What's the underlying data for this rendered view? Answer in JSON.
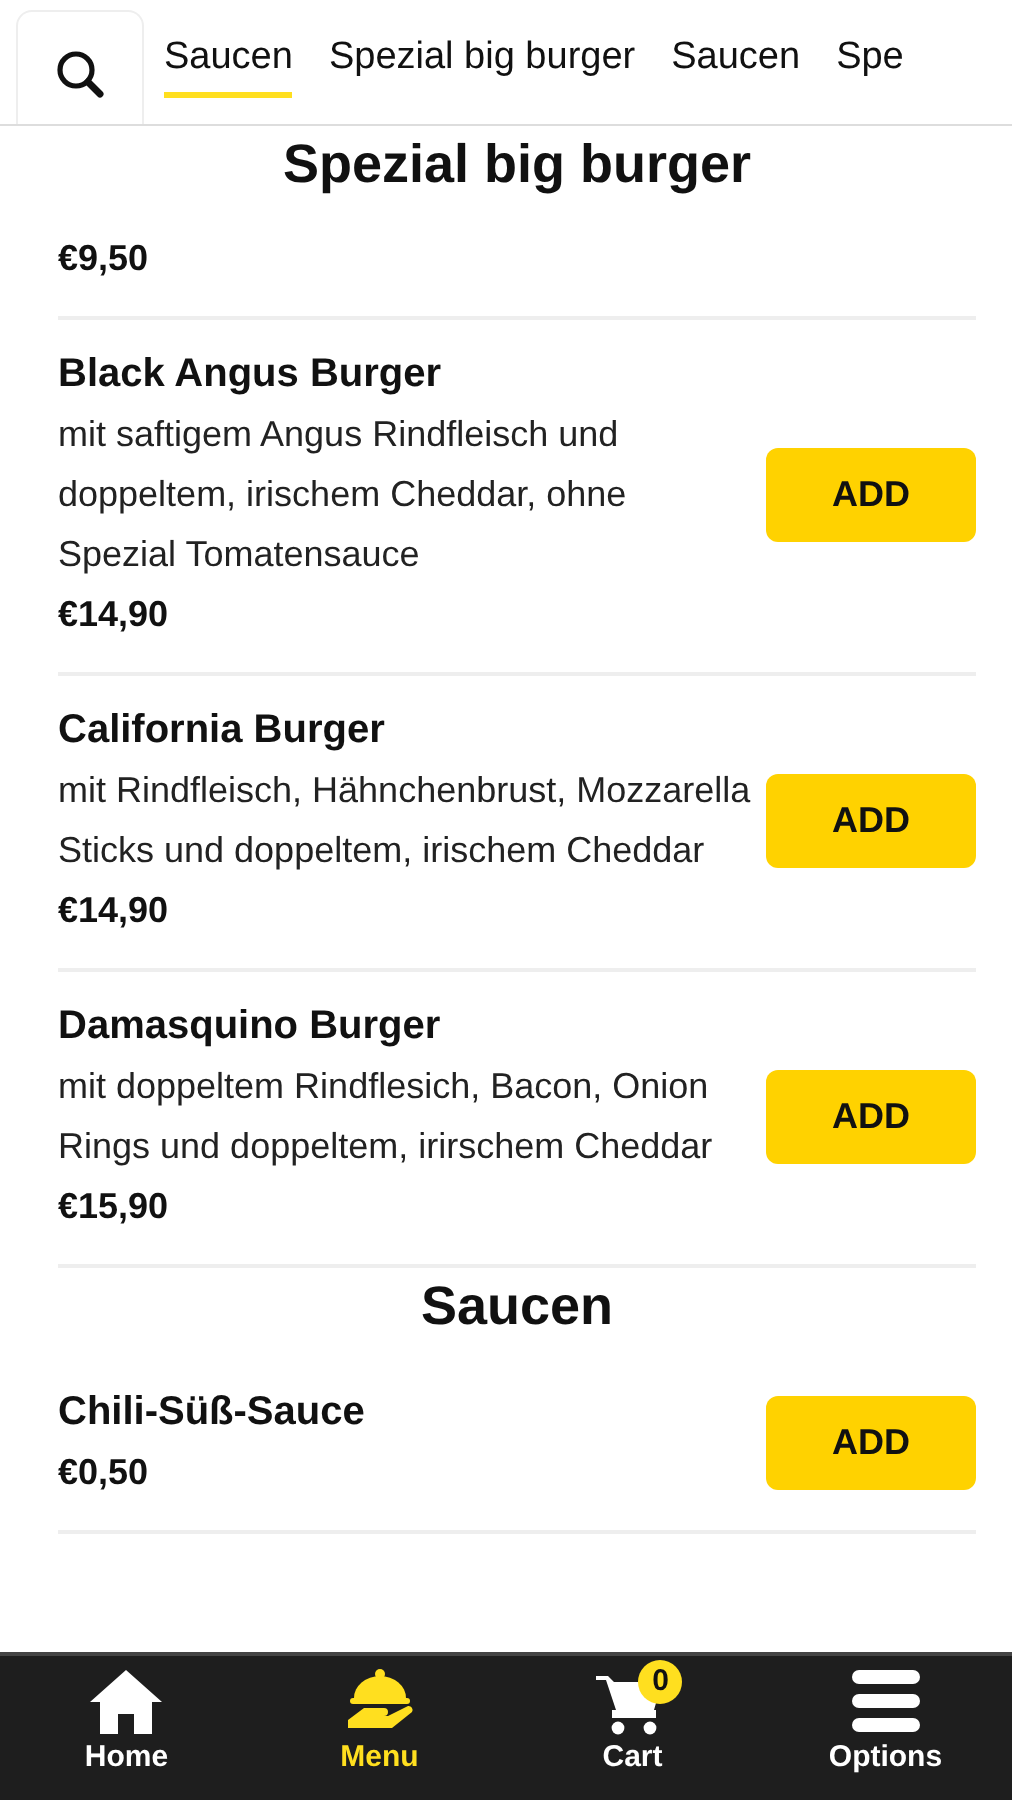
{
  "tabs": [
    {
      "label": "Saucen",
      "selected": true
    },
    {
      "label": "Spezial big burger",
      "selected": false
    },
    {
      "label": "Saucen",
      "selected": false
    },
    {
      "label": "Spe",
      "selected": false
    }
  ],
  "sections": [
    {
      "title": "Spezial big burger",
      "items": [
        {
          "price": "€9,50"
        },
        {
          "name": "Black Angus Burger",
          "description": "mit saftigem Angus Rindfleisch und doppeltem, irischem Cheddar, ohne Spezial Tomatensauce",
          "price": "€14,90",
          "button": "ADD"
        },
        {
          "name": "California Burger",
          "description": "mit Rindfleisch, Hähnchenbrust, Mozzarella Sticks und doppeltem, irischem Cheddar",
          "price": "€14,90",
          "button": "ADD"
        },
        {
          "name": "Damasquino Burger",
          "description": "mit doppeltem Rindflesich, Bacon, Onion Rings und doppeltem, irirschem Cheddar",
          "price": "€15,90",
          "button": "ADD"
        }
      ]
    },
    {
      "title": "Saucen",
      "items": [
        {
          "name": "Chili-Süß-Sauce",
          "price": "€0,50",
          "button": "ADD"
        }
      ]
    }
  ],
  "nav": [
    {
      "kind": "home",
      "label": "Home",
      "selected": false
    },
    {
      "kind": "menu",
      "label": "Menu",
      "selected": true
    },
    {
      "kind": "cart",
      "label": "Cart",
      "selected": false,
      "badge": "0"
    },
    {
      "kind": "options",
      "label": "Options",
      "selected": false
    }
  ]
}
